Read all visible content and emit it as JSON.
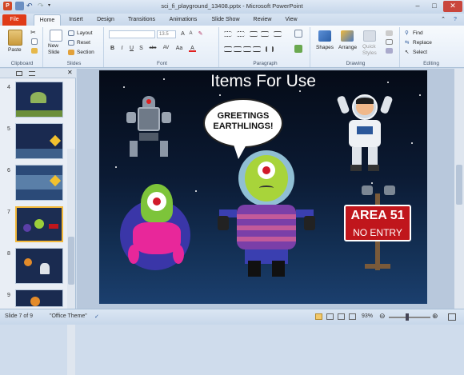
{
  "titlebar": {
    "title": "sci_fi_playground_13408.pptx - Microsoft PowerPoint",
    "minimize": "–",
    "maximize": "□",
    "close": "✕"
  },
  "tabs": [
    "File",
    "Home",
    "Insert",
    "Design",
    "Transitions",
    "Animations",
    "Slide Show",
    "Review",
    "View"
  ],
  "ribbon": {
    "paste": "Paste",
    "new_slide": "New\nSlide",
    "layout": "Layout",
    "reset": "Reset",
    "section": "Section",
    "font_size": "13.5",
    "shapes": "Shapes",
    "arrange": "Arrange",
    "quick_styles": "Quick\nStyles",
    "find": "Find",
    "replace": "Replace",
    "select": "Select",
    "groups": [
      "Clipboard",
      "Slides",
      "Font",
      "Paragraph",
      "Drawing",
      "Editing"
    ],
    "font_buttons": [
      "B",
      "I",
      "U",
      "S",
      "abc",
      "AV",
      "Aa",
      "A"
    ]
  },
  "thumbnails": [
    {
      "num": "4",
      "bg": "#1a2c55"
    },
    {
      "num": "5",
      "bg": "#1a2a50"
    },
    {
      "num": "6",
      "bg": "#2b4a78"
    },
    {
      "num": "7",
      "bg": "#1c2d52"
    },
    {
      "num": "8",
      "bg": "#1a2b50"
    },
    {
      "num": "9",
      "bg": "#1a2b50"
    }
  ],
  "slide": {
    "title": "Items For Use",
    "bubble": "GREETINGS\nEARTHLINGS!",
    "sign_title": "AREA 51",
    "sign_sub": "NO ENTRY"
  },
  "status": {
    "slide": "Slide 7 of 9",
    "theme": "\"Office Theme\"",
    "zoom": "93%"
  },
  "colors": {
    "file_tab": "#e03b18",
    "accent": "#2b579a",
    "sign_red": "#c0161c"
  }
}
